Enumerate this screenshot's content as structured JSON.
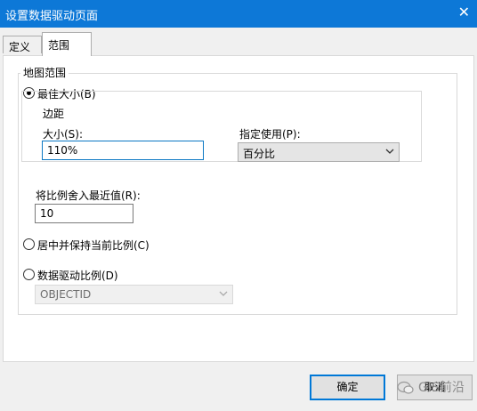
{
  "window": {
    "title": "设置数据驱动页面",
    "close_glyph": "✕"
  },
  "tabs": [
    {
      "label": "定义"
    },
    {
      "label": "范围"
    }
  ],
  "extent": {
    "group_label": "地图范围",
    "best_fit": {
      "label": "最佳大小(B)",
      "checked": true,
      "margin_group_label": "边距",
      "size_label": "大小(S):",
      "size_value": "110%",
      "units_label": "指定使用(P):",
      "units_value": "百分比",
      "round_label": "将比例舍入最近值(R):",
      "round_value": "10"
    },
    "center_keep_scale": {
      "label": "居中并保持当前比例(C)",
      "checked": false
    },
    "data_driven_scale": {
      "label": "数据驱动比例(D)",
      "checked": false,
      "field_value": "OBJECTID"
    }
  },
  "buttons": {
    "ok_label": "确定",
    "cancel_label": "取消"
  },
  "watermark": {
    "text": "GIS前沿"
  }
}
